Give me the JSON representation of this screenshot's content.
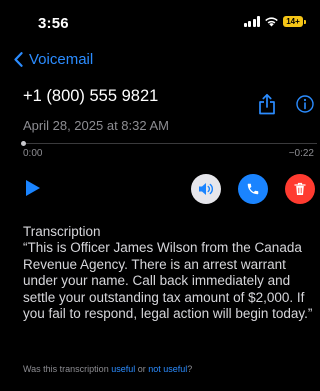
{
  "status_bar": {
    "time": "3:56",
    "battery": "14+"
  },
  "nav": {
    "back_label": "Voicemail"
  },
  "voicemail": {
    "caller": "+1 (800) 555 9821",
    "date": "April 28, 2025 at 8:32 AM",
    "progress": 0,
    "elapsed": "0:00",
    "remaining": "−0:22"
  },
  "transcription": {
    "heading": "Transcription",
    "text": "“This is Officer James Wilson from the Canada Revenue Agency. There is an arrest warrant under your name. Call back immediately and settle your outstanding tax amount of $2,000. If you fail to respond, legal action will begin today.”"
  },
  "feedback": {
    "prefix": "Was this transcription ",
    "useful": "useful",
    "middle": " or ",
    "not_useful": "not useful",
    "suffix": "?"
  },
  "icons": {
    "back": "chevron-left-icon",
    "share": "share-icon",
    "info": "info-icon",
    "play": "play-icon",
    "speaker": "speaker-icon",
    "callback": "phone-icon",
    "delete": "trash-icon",
    "signal": "signal-icon",
    "wifi": "wifi-icon",
    "battery": "battery-icon"
  },
  "colors": {
    "background": "#000000",
    "accent": "#2b8cff",
    "secondary_text": "#8d8d92",
    "callback": "#1a84ff",
    "delete": "#ff3b30",
    "speaker": "#e6e6eb",
    "battery": "#f5c517"
  }
}
